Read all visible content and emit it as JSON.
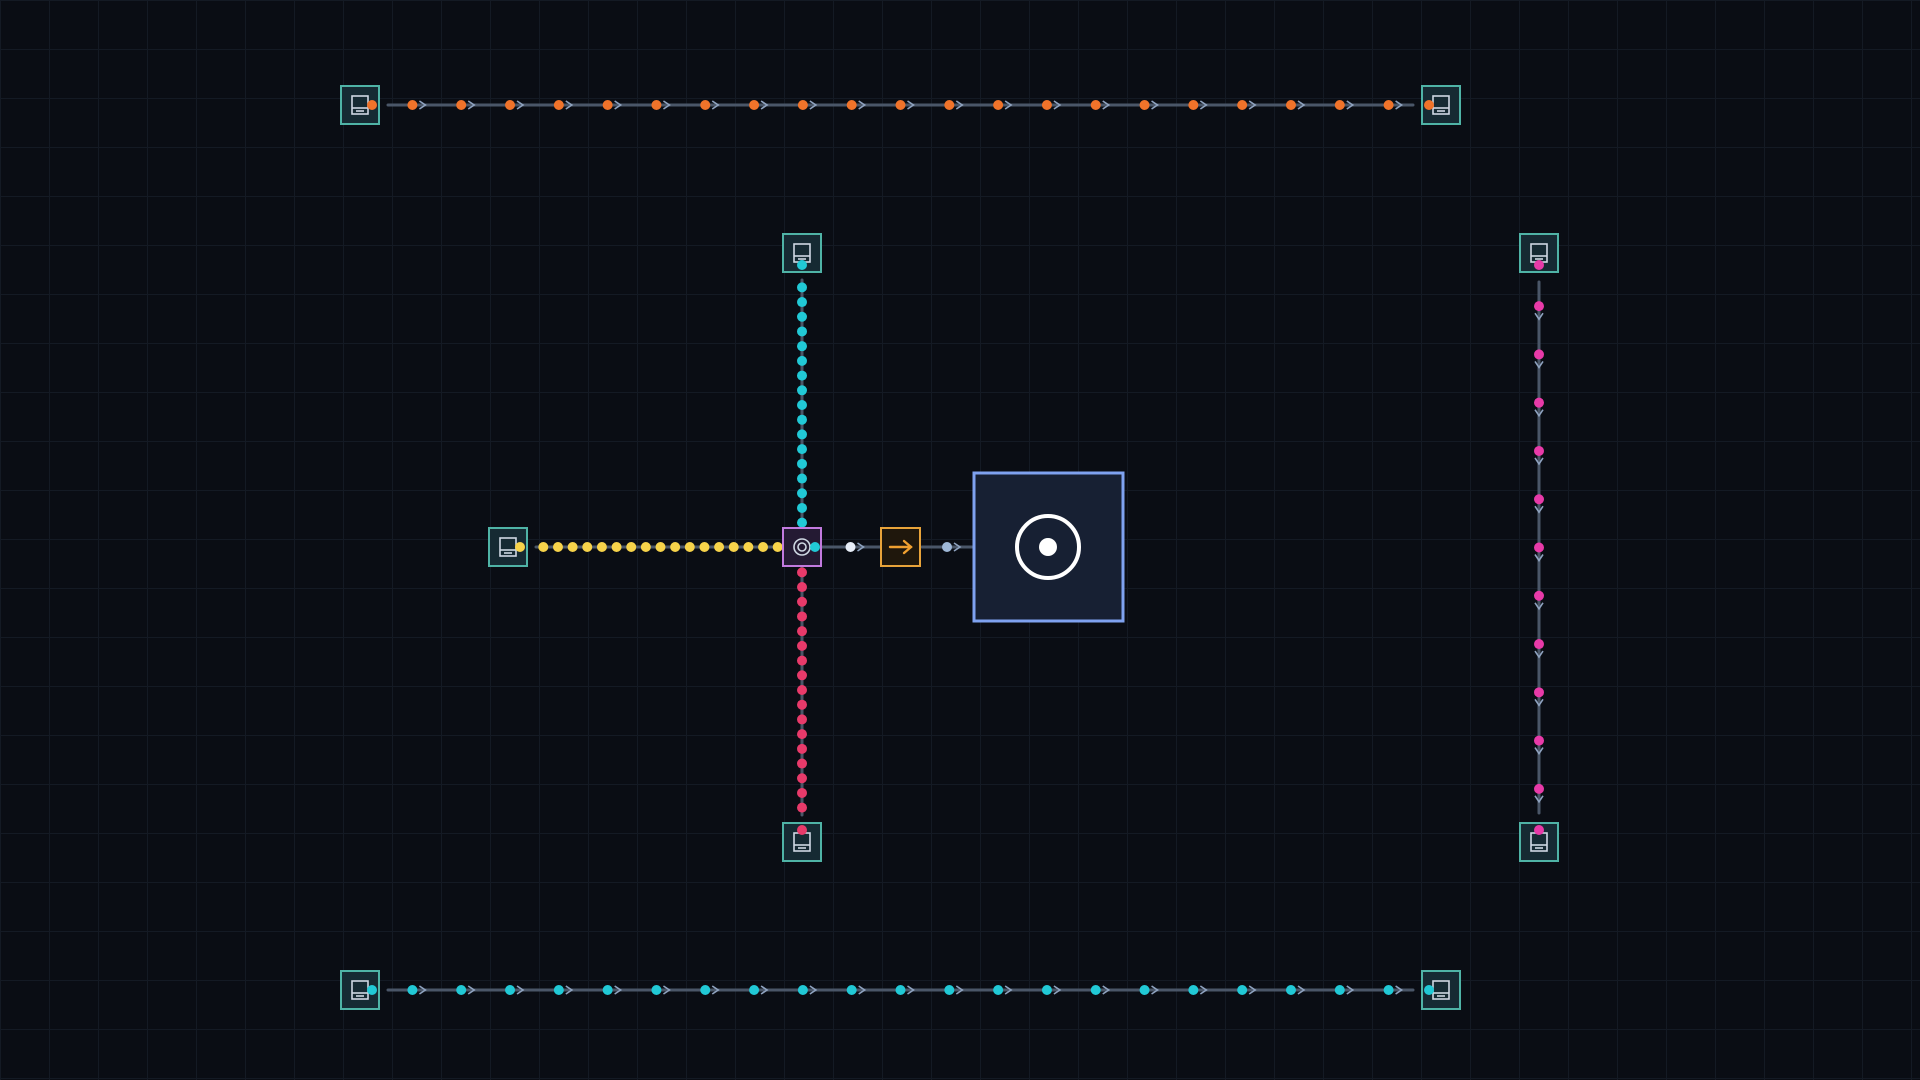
{
  "game": {
    "grid_cell": 49,
    "colors": {
      "background": "#0a0d14",
      "grid": "#141a24",
      "belt": "#4a5668",
      "arrow": "#8fa3c0",
      "node_fill": "#162a33",
      "node_border": "#4fb3a6",
      "node_icon": "#cfd8e3",
      "hub_fill": "#172033",
      "hub_border": "#7fa2f0",
      "hub_icon": "#ffffff",
      "router_fill": "#241a33",
      "router_border": "#c27adf",
      "output_fill": "#1f170c",
      "output_border": "#e8a33a",
      "output_arrow": "#f0a030",
      "orange": "#f0732a",
      "cyan": "#21c9d6",
      "yellow": "#f7d34a",
      "red": "#e83a6a",
      "magenta": "#e83aa8",
      "white": "#e8eef8",
      "pale_blue": "#9fb8d8"
    },
    "nodes": [
      {
        "id": "extractor-top-left",
        "icon": "extractor-icon",
        "dir": "right",
        "color": "orange"
      },
      {
        "id": "extractor-top-right",
        "icon": "extractor-icon",
        "dir": "left",
        "color": "orange"
      },
      {
        "id": "extractor-center-top",
        "icon": "extractor-icon",
        "dir": "down",
        "color": "cyan"
      },
      {
        "id": "extractor-left",
        "icon": "extractor-icon",
        "dir": "right",
        "color": "yellow"
      },
      {
        "id": "extractor-center-bottom",
        "icon": "extractor-icon",
        "dir": "up",
        "color": "red"
      },
      {
        "id": "extractor-right-top",
        "icon": "extractor-icon",
        "dir": "down",
        "color": "magenta"
      },
      {
        "id": "extractor-right-bottom",
        "icon": "extractor-icon",
        "dir": "up",
        "color": "magenta"
      },
      {
        "id": "extractor-bottom-left",
        "icon": "extractor-icon",
        "dir": "right",
        "color": "cyan"
      },
      {
        "id": "extractor-bottom-right",
        "icon": "extractor-icon",
        "dir": "left",
        "color": "cyan"
      }
    ],
    "belts": [
      {
        "id": "belt-top",
        "color": "orange",
        "items": 21,
        "arrows": true
      },
      {
        "id": "belt-bottom",
        "color": "cyan",
        "items": 21,
        "arrows": true
      },
      {
        "id": "belt-right",
        "color": "magenta",
        "items": 11,
        "arrows": true
      },
      {
        "id": "belt-center-up",
        "color": "cyan",
        "items": 17,
        "arrows": false
      },
      {
        "id": "belt-center-down",
        "color": "red",
        "items": 17,
        "arrows": false
      },
      {
        "id": "belt-left-yellow",
        "color": "yellow",
        "items": 17,
        "arrows": false
      },
      {
        "id": "belt-router-out",
        "color": "white",
        "items": 1,
        "arrows": true
      },
      {
        "id": "belt-hub-in",
        "color": "pale_blue",
        "items": 1,
        "arrows": true
      }
    ],
    "router": {
      "id": "merger-router",
      "icon": "spiral-icon"
    },
    "output": {
      "id": "output-node",
      "icon": "arrow-right-icon"
    },
    "hub": {
      "id": "central-hub",
      "icon": "target-icon"
    }
  }
}
